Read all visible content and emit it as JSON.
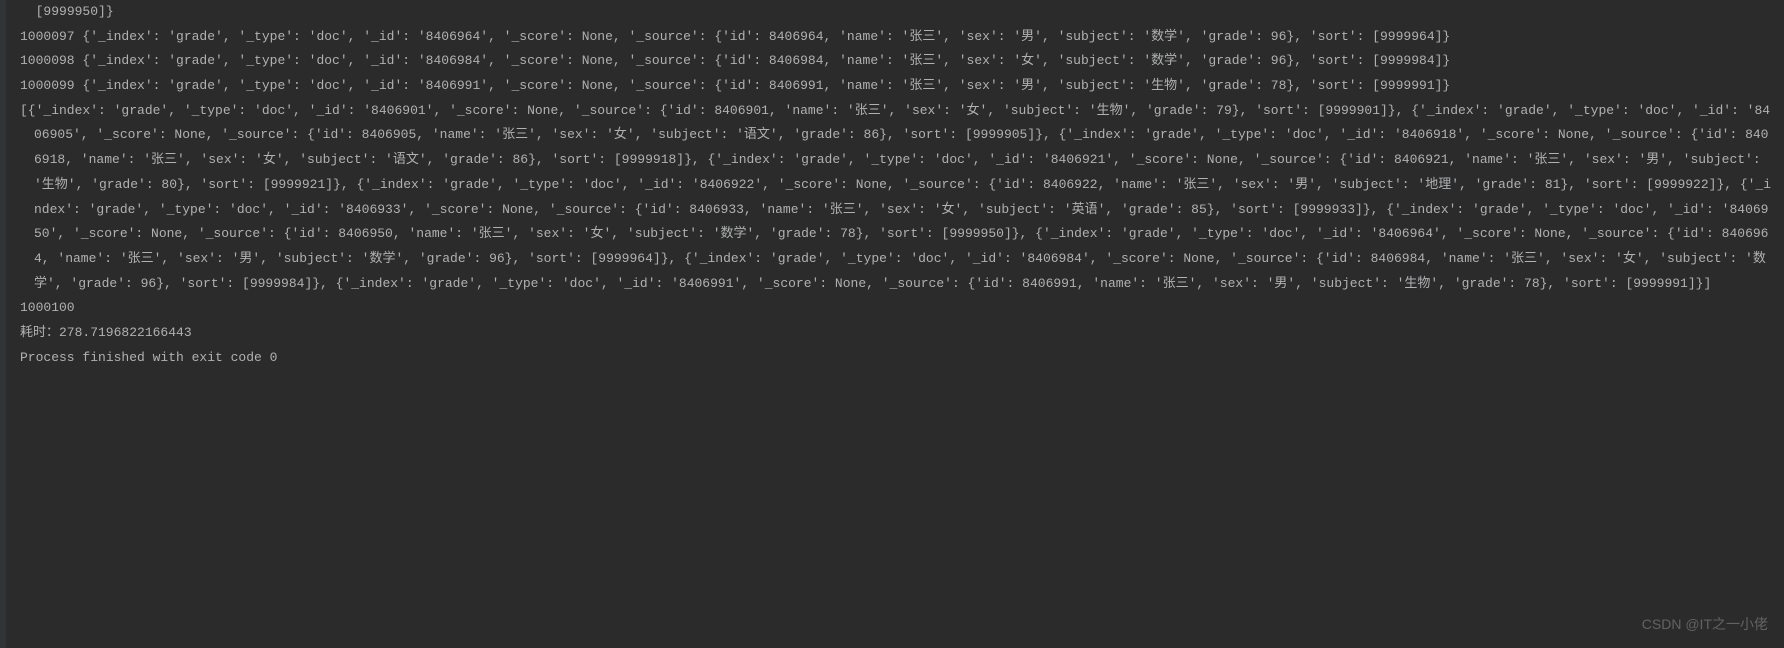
{
  "console": {
    "lines": [
      "  [9999950]}",
      "1000097 {'_index': 'grade', '_type': 'doc', '_id': '8406964', '_score': None, '_source': {'id': 8406964, 'name': '张三', 'sex': '男', 'subject': '数学', 'grade': 96}, 'sort': [9999964]}",
      "1000098 {'_index': 'grade', '_type': 'doc', '_id': '8406984', '_score': None, '_source': {'id': 8406984, 'name': '张三', 'sex': '女', 'subject': '数学', 'grade': 96}, 'sort': [9999984]}",
      "1000099 {'_index': 'grade', '_type': 'doc', '_id': '8406991', '_score': None, '_source': {'id': 8406991, 'name': '张三', 'sex': '男', 'subject': '生物', 'grade': 78}, 'sort': [9999991]}",
      "[{'_index': 'grade', '_type': 'doc', '_id': '8406901', '_score': None, '_source': {'id': 8406901, 'name': '张三', 'sex': '女', 'subject': '生物', 'grade': 79}, 'sort': [9999901]}, {'_index': 'grade', '_type': 'doc', '_id': '8406905', '_score': None, '_source': {'id': 8406905, 'name': '张三', 'sex': '女', 'subject': '语文', 'grade': 86}, 'sort': [9999905]}, {'_index': 'grade', '_type': 'doc', '_id': '8406918', '_score': None, '_source': {'id': 8406918, 'name': '张三', 'sex': '女', 'subject': '语文', 'grade': 86}, 'sort': [9999918]}, {'_index': 'grade', '_type': 'doc', '_id': '8406921', '_score': None, '_source': {'id': 8406921, 'name': '张三', 'sex': '男', 'subject': '生物', 'grade': 80}, 'sort': [9999921]}, {'_index': 'grade', '_type': 'doc', '_id': '8406922', '_score': None, '_source': {'id': 8406922, 'name': '张三', 'sex': '男', 'subject': '地理', 'grade': 81}, 'sort': [9999922]}, {'_index': 'grade', '_type': 'doc', '_id': '8406933', '_score': None, '_source': {'id': 8406933, 'name': '张三', 'sex': '女', 'subject': '英语', 'grade': 85}, 'sort': [9999933]}, {'_index': 'grade', '_type': 'doc', '_id': '8406950', '_score': None, '_source': {'id': 8406950, 'name': '张三', 'sex': '女', 'subject': '数学', 'grade': 78}, 'sort': [9999950]}, {'_index': 'grade', '_type': 'doc', '_id': '8406964', '_score': None, '_source': {'id': 8406964, 'name': '张三', 'sex': '男', 'subject': '数学', 'grade': 96}, 'sort': [9999964]}, {'_index': 'grade', '_type': 'doc', '_id': '8406984', '_score': None, '_source': {'id': 8406984, 'name': '张三', 'sex': '女', 'subject': '数学', 'grade': 96}, 'sort': [9999984]}, {'_index': 'grade', '_type': 'doc', '_id': '8406991', '_score': None, '_source': {'id': 8406991, 'name': '张三', 'sex': '男', 'subject': '生物', 'grade': 78}, 'sort': [9999991]}]",
      "1000100",
      "耗时：278.7196822166443",
      "",
      "Process finished with exit code 0"
    ]
  },
  "watermark": "CSDN @IT之一小佬"
}
